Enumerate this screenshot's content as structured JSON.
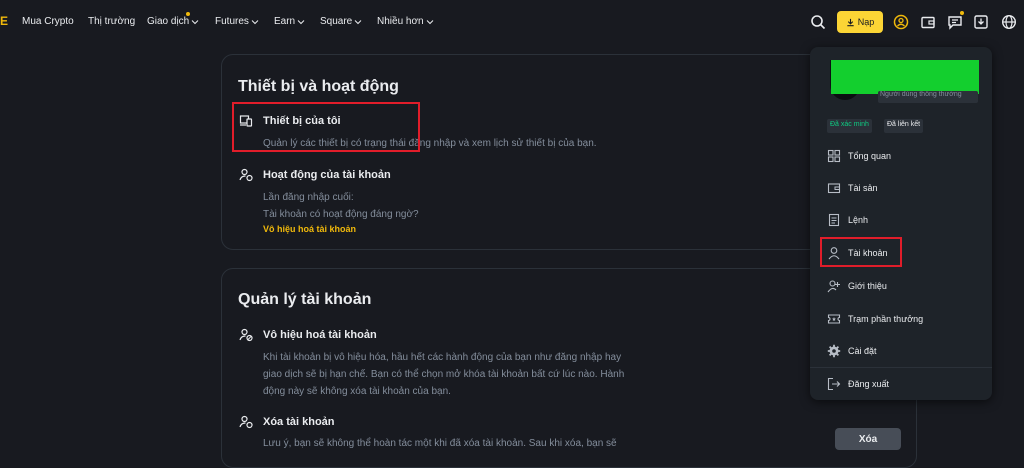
{
  "nav": {
    "logo_letter": "E",
    "items": [
      {
        "label": "Mua Crypto"
      },
      {
        "label": "Thị trường"
      },
      {
        "label": "Giao dịch"
      },
      {
        "label": "Futures"
      },
      {
        "label": "Earn"
      },
      {
        "label": "Square"
      },
      {
        "label": "Nhiều hơn"
      }
    ],
    "deposit_label": "Nạp",
    "accent": "#f0b90b"
  },
  "devices_card": {
    "title": "Thiết bị và hoạt động",
    "my_devices": {
      "title": "Thiết bị của tôi",
      "desc": "Quản lý các thiết bị có trạng thái đăng nhập và xem lịch sử thiết bị của bạn."
    },
    "account_activity": {
      "title": "Hoạt động của tài khoản",
      "line1": "Lần đăng nhập cuối:",
      "line2": "Tài khoản có hoạt động đáng ngờ?",
      "link": "Vô hiệu hoá tài khoản"
    }
  },
  "account_card": {
    "title": "Quản lý tài khoản",
    "disable": {
      "title": "Vô hiệu hoá tài khoản",
      "desc_lines": [
        "Khi tài khoản bị vô hiệu hóa, hầu hết các hành động của bạn như đăng nhập hay",
        "giao dịch sẽ bị hạn chế. Bạn có thể chọn mở khóa tài khoản bất cứ lúc nào. Hành",
        "động này sẽ không xóa tài khoản của bạn."
      ]
    },
    "delete": {
      "title": "Xóa tài khoản",
      "desc": "Lưu ý, bạn sẽ không thể hoàn tác một khi đã xóa tài khoản. Sau khi xóa, bạn sẽ",
      "button": "Xóa"
    }
  },
  "dropdown": {
    "user_type": "Người dùng thông thường",
    "badge_verified": "Đã xác minh",
    "badge_linked": "Đã liên kết",
    "verified_color": "#0ecb81",
    "items": [
      {
        "label": "Tổng quan",
        "icon": "dashboard-icon"
      },
      {
        "label": "Tài sản",
        "icon": "wallet-icon"
      },
      {
        "label": "Lệnh",
        "icon": "orders-icon"
      },
      {
        "label": "Tài khoản",
        "icon": "user-icon"
      },
      {
        "label": "Giới thiệu",
        "icon": "referral-icon"
      },
      {
        "label": "Trạm phần thưởng",
        "icon": "ticket-icon"
      },
      {
        "label": "Cài đặt",
        "icon": "gear-icon"
      },
      {
        "label": "Đăng xuất",
        "icon": "logout-icon"
      }
    ]
  }
}
